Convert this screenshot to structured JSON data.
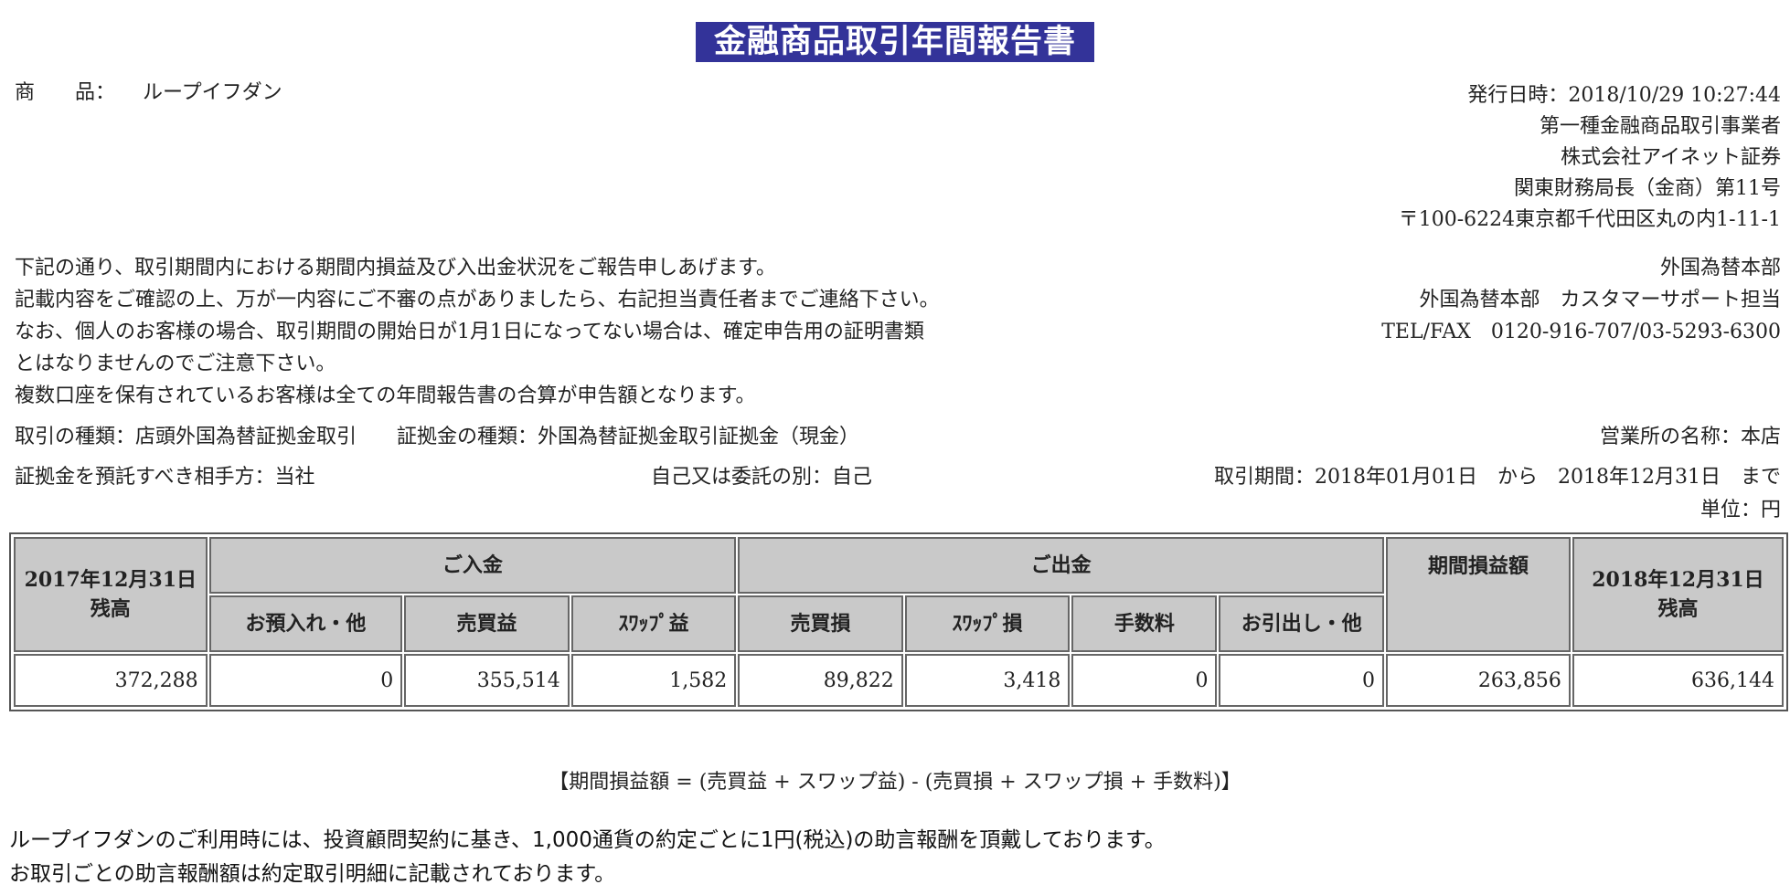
{
  "title": "金融商品取引年間報告書",
  "product": {
    "label": "商　　品：",
    "value": "ループイフダン"
  },
  "issuer": {
    "issued_at": "発行日時：2018/10/29 10:27:44",
    "lines": [
      "第一種金融商品取引事業者",
      "株式会社アイネット証券",
      "関東財務局長（金商）第11号",
      "〒100-6224東京都千代田区丸の内1-11-1"
    ]
  },
  "notice": [
    "下記の通り、取引期間内における期間内損益及び入出金状況をご報告申しあげます。",
    "記載内容をご確認の上、万が一内容にご不審の点がありましたら、右記担当責任者までご連絡下さい。",
    "なお、個人のお客様の場合、取引期間の開始日が1月1日になってない場合は、確定申告用の証明書類",
    "とはなりませんのでご注意下さい。",
    "複数口座を保有されているお客様は全ての年間報告書の合算が申告額となります。"
  ],
  "contact": [
    "外国為替本部",
    "外国為替本部　カスタマーサポート担当",
    "TEL/FAX　0120-916-707/03-5293-6300"
  ],
  "meta": {
    "trade_type": "取引の種類：店頭外国為替証拠金取引",
    "margin_type": "証拠金の種類：外国為替証拠金取引証拠金（現金）",
    "office": "営業所の名称：本店",
    "counterparty": "証拠金を預託すべき相手方：当社",
    "self_or_consign": "自己又は委託の別：自己",
    "period": "取引期間：2018年01月01日　から　2018年12月31日　まで",
    "unit": "単位：円"
  },
  "table": {
    "h_open_1": "2017年12月31日",
    "h_open_2": "残高",
    "h_deposit": "ご入金",
    "h_withdraw": "ご出金",
    "h_pl": "期間損益額",
    "h_close_1": "2018年12月31日",
    "h_close_2": "残高",
    "sub": [
      "お預入れ・他",
      "売買益",
      "ｽﾜｯﾌﾟ益",
      "売買損",
      "ｽﾜｯﾌﾟ損",
      "手数料",
      "お引出し・他"
    ],
    "row": [
      "372,288",
      "0",
      "355,514",
      "1,582",
      "89,822",
      "3,418",
      "0",
      "0",
      "263,856",
      "636,144"
    ]
  },
  "formula": "【期間損益額 = (売買益 + スワップ益) - (売買損 + スワップ損 + 手数料)】",
  "footer": [
    "ループイフダンのご利用時には、投資顧問契約に基き、1,000通貨の約定ごとに1円(税込)の助言報酬を頂戴しております。",
    "お取引ごとの助言報酬額は約定取引明細に記載されております。"
  ]
}
